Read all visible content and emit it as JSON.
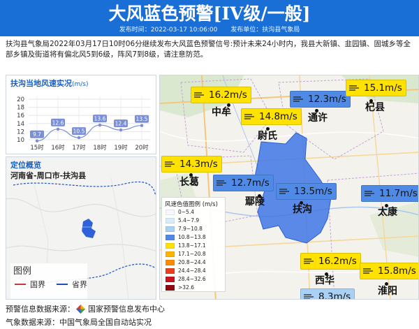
{
  "header": {
    "title": "大风蓝色预警[IV级/一般]",
    "publish_time": "发布时间：2022-03-17 10:06:00",
    "publisher": "发布单位：扶沟县气象局",
    "bg_color": "#1a6fd6"
  },
  "description": "扶沟县气象局2022年03月17日10时06分继续发布大风蓝色预警信号:预计未来24小时内，我县大新镇、韭园镇、固城乡等全部乡镇及街道将有偏北风5到6级，阵风7到8级，请注意防范。",
  "wind_panel": {
    "title": "扶沟当地风速实况",
    "unit": "(m/s)"
  },
  "chart_data": {
    "type": "line",
    "title": "扶沟当地风速实况 (m/s)",
    "categories": [
      "15时",
      "16时",
      "17时",
      "18时",
      "19时",
      "20时"
    ],
    "values": [
      9.7,
      12.6,
      10.5,
      13.6,
      12.4,
      13.5
    ],
    "ylim": [
      10,
      20
    ],
    "yticks": [
      10,
      12,
      14,
      16,
      18,
      20
    ],
    "grid": true,
    "line_color": "#7b8fd6"
  },
  "locate_panel": {
    "title": "定位概览",
    "location": "河南省-周口市-扶沟县",
    "legend_title": "图例",
    "legend_items": [
      {
        "label": "国界",
        "color": "#c23a3a"
      },
      {
        "label": "省界",
        "color": "#1f4fbf"
      }
    ]
  },
  "map": {
    "badges": [
      {
        "value": "16.2m/s",
        "color": "#ffe200"
      },
      {
        "value": "12.3m/s",
        "color": "#4f8ae6"
      },
      {
        "value": "15.1m/s",
        "color": "#ffe200"
      },
      {
        "value": "14.8m/s",
        "color": "#ffe200"
      },
      {
        "value": "14.3m/s",
        "color": "#ffe200"
      },
      {
        "value": "12.7m/s",
        "color": "#4f8ae6"
      },
      {
        "value": "13.5m/s",
        "color": "#4f8ae6"
      },
      {
        "value": "11.7m/s",
        "color": "#4f8ae6"
      },
      {
        "value": "16.2m/s",
        "color": "#ffe200"
      },
      {
        "value": "15.8m/s",
        "color": "#ffe200"
      },
      {
        "value": "8.3m/s",
        "color": "#a9d0f5"
      }
    ],
    "cities": [
      "中牟",
      "通许",
      "杞县",
      "尉氏",
      "长葛",
      "鄢陵",
      "扶沟",
      "太康",
      "西华",
      "淮阳"
    ]
  },
  "wind_legend": {
    "title": "风速色值图例 (m/s)",
    "items": [
      {
        "label": "0~5.4",
        "color": "#f5f9ff"
      },
      {
        "label": "5.4~7.9",
        "color": "#d8ebfb"
      },
      {
        "label": "7.9~10.8",
        "color": "#a9d0f5"
      },
      {
        "label": "10.8~13.8",
        "color": "#4f8ae6"
      },
      {
        "label": "13.8~17.1",
        "color": "#ffe200"
      },
      {
        "label": "17.1~20.8",
        "color": "#ffb400"
      },
      {
        "label": "20.8~24.4",
        "color": "#ff8c00"
      },
      {
        "label": "24.4~28.4",
        "color": "#e8401c"
      },
      {
        "label": "28.4~32.6",
        "color": "#c8141c"
      },
      {
        "label": ">32.6",
        "color": "#8e0a10"
      }
    ]
  },
  "footer": {
    "warning_source_label": "预警信息数据来源：",
    "warning_source": "国家预警信息发布中心",
    "weather_source": "气象数据来源：中国气象局全国自动站实况"
  }
}
